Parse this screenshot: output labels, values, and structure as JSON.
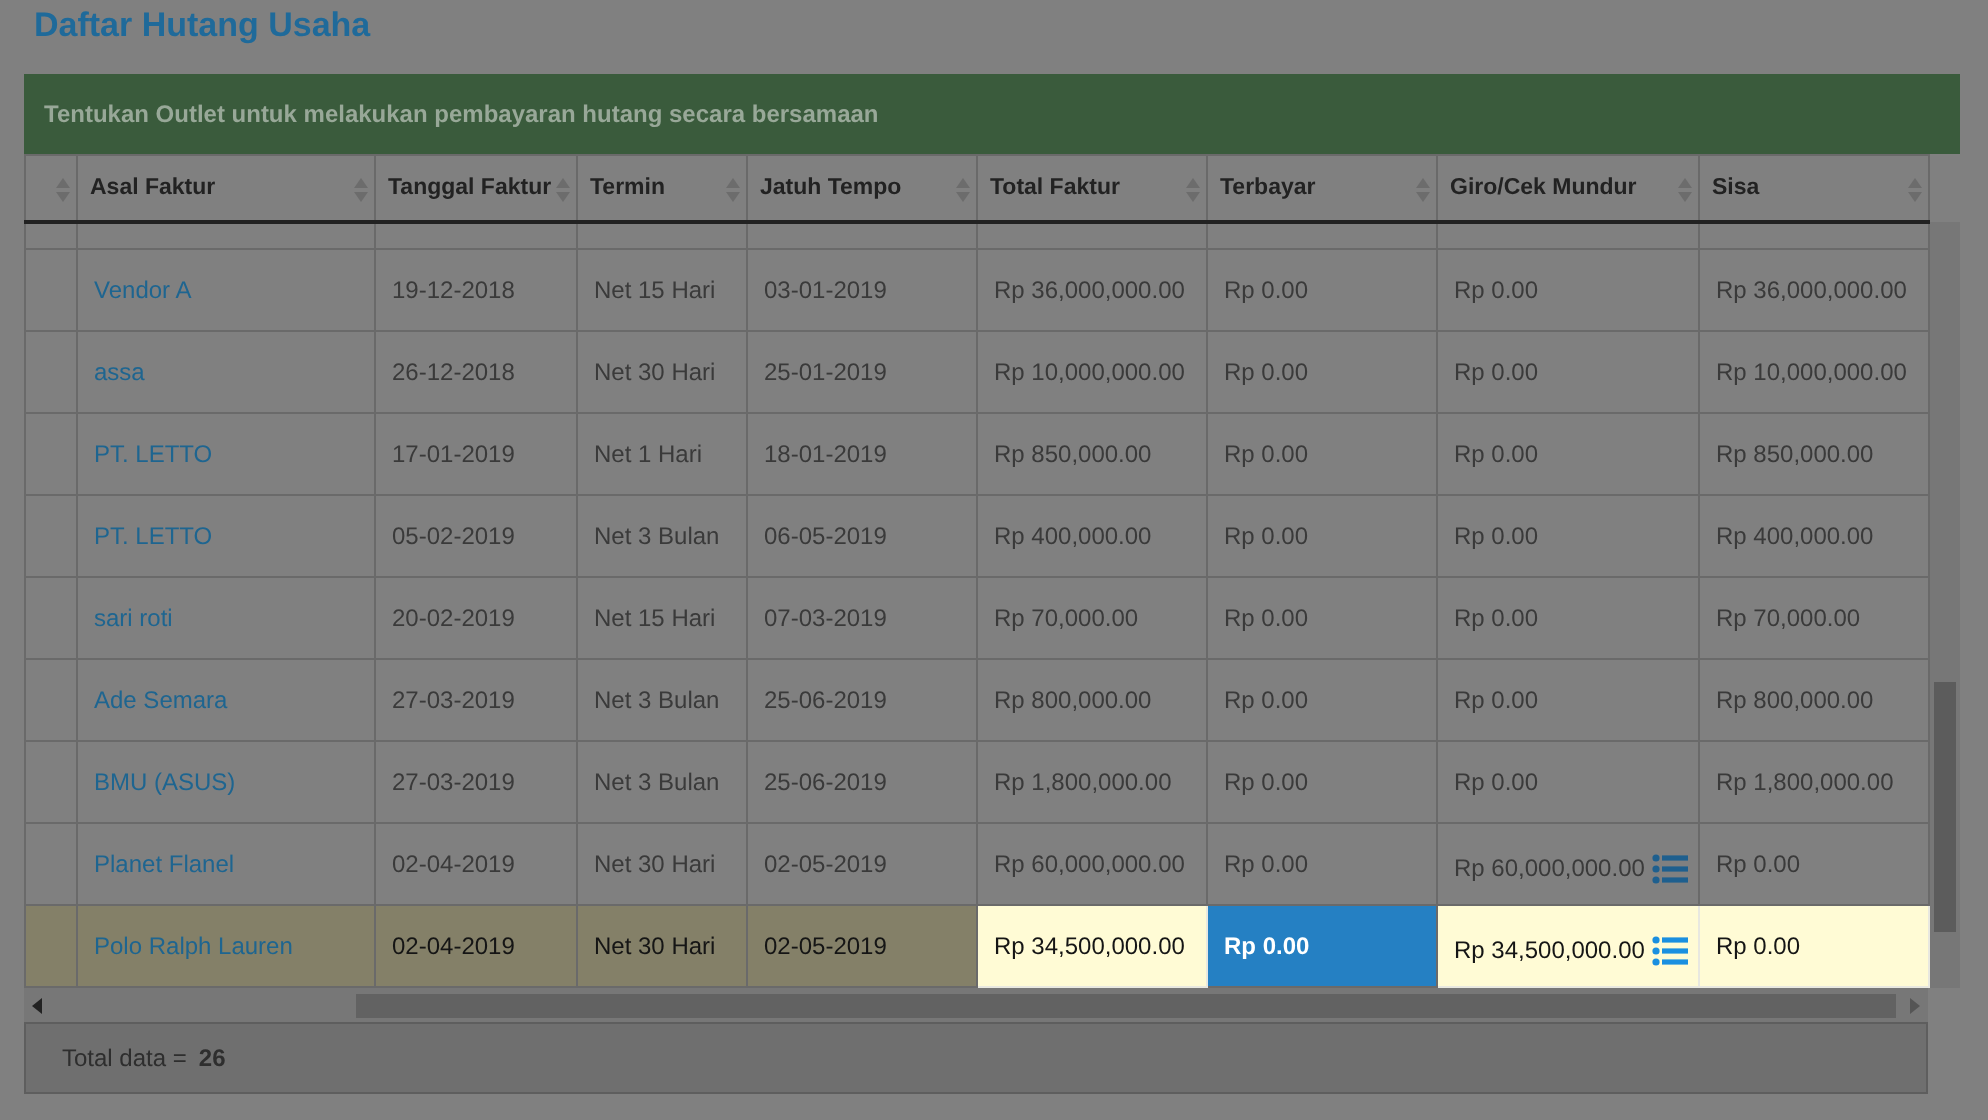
{
  "title": "Daftar Hutang Usaha",
  "notice": "Tentukan Outlet untuk melakukan pembayaran hutang secara bersamaan",
  "table": {
    "columns": [
      "Asal Faktur",
      "Tanggal Faktur",
      "Termin",
      "Jatuh Tempo",
      "Total Faktur",
      "Terbayar",
      "Giro/Cek Mundur",
      "Sisa"
    ],
    "rows": [
      {
        "vendor": "Vendor A",
        "date": "19-12-2018",
        "term": "Net 15 Hari",
        "due": "03-01-2019",
        "total": "Rp 36,000,000.00",
        "paid": "Rp 0.00",
        "giro": "Rp 0.00",
        "giro_detail": false,
        "rest": "Rp 36,000,000.00",
        "selected": false,
        "paid_focused": false
      },
      {
        "vendor": "assa",
        "date": "26-12-2018",
        "term": "Net 30 Hari",
        "due": "25-01-2019",
        "total": "Rp 10,000,000.00",
        "paid": "Rp 0.00",
        "giro": "Rp 0.00",
        "giro_detail": false,
        "rest": "Rp 10,000,000.00",
        "selected": false,
        "paid_focused": false
      },
      {
        "vendor": "PT. LETTO",
        "date": "17-01-2019",
        "term": "Net 1 Hari",
        "due": "18-01-2019",
        "total": "Rp 850,000.00",
        "paid": "Rp 0.00",
        "giro": "Rp 0.00",
        "giro_detail": false,
        "rest": "Rp 850,000.00",
        "selected": false,
        "paid_focused": false
      },
      {
        "vendor": "PT. LETTO",
        "date": "05-02-2019",
        "term": "Net 3 Bulan",
        "due": "06-05-2019",
        "total": "Rp 400,000.00",
        "paid": "Rp 0.00",
        "giro": "Rp 0.00",
        "giro_detail": false,
        "rest": "Rp 400,000.00",
        "selected": false,
        "paid_focused": false
      },
      {
        "vendor": "sari roti",
        "date": "20-02-2019",
        "term": "Net 15 Hari",
        "due": "07-03-2019",
        "total": "Rp 70,000.00",
        "paid": "Rp 0.00",
        "giro": "Rp 0.00",
        "giro_detail": false,
        "rest": "Rp 70,000.00",
        "selected": false,
        "paid_focused": false
      },
      {
        "vendor": "Ade Semara",
        "date": "27-03-2019",
        "term": "Net 3 Bulan",
        "due": "25-06-2019",
        "total": "Rp 800,000.00",
        "paid": "Rp 0.00",
        "giro": "Rp 0.00",
        "giro_detail": false,
        "rest": "Rp 800,000.00",
        "selected": false,
        "paid_focused": false
      },
      {
        "vendor": "BMU (ASUS)",
        "date": "27-03-2019",
        "term": "Net 3 Bulan",
        "due": "25-06-2019",
        "total": "Rp 1,800,000.00",
        "paid": "Rp 0.00",
        "giro": "Rp 0.00",
        "giro_detail": false,
        "rest": "Rp 1,800,000.00",
        "selected": false,
        "paid_focused": false
      },
      {
        "vendor": "Planet Flanel",
        "date": "02-04-2019",
        "term": "Net 30 Hari",
        "due": "02-05-2019",
        "total": "Rp 60,000,000.00",
        "paid": "Rp 0.00",
        "giro": "Rp 60,000,000.00",
        "giro_detail": true,
        "rest": "Rp 0.00",
        "selected": false,
        "paid_focused": false
      },
      {
        "vendor": "Polo Ralph Lauren",
        "date": "02-04-2019",
        "term": "Net 30 Hari",
        "due": "02-05-2019",
        "total": "Rp 34,500,000.00",
        "paid": "Rp 0.00",
        "giro": "Rp 34,500,000.00",
        "giro_detail": true,
        "rest": "Rp 0.00",
        "selected": true,
        "paid_focused": true
      }
    ]
  },
  "footer": {
    "label": "Total data =",
    "count": "26"
  }
}
